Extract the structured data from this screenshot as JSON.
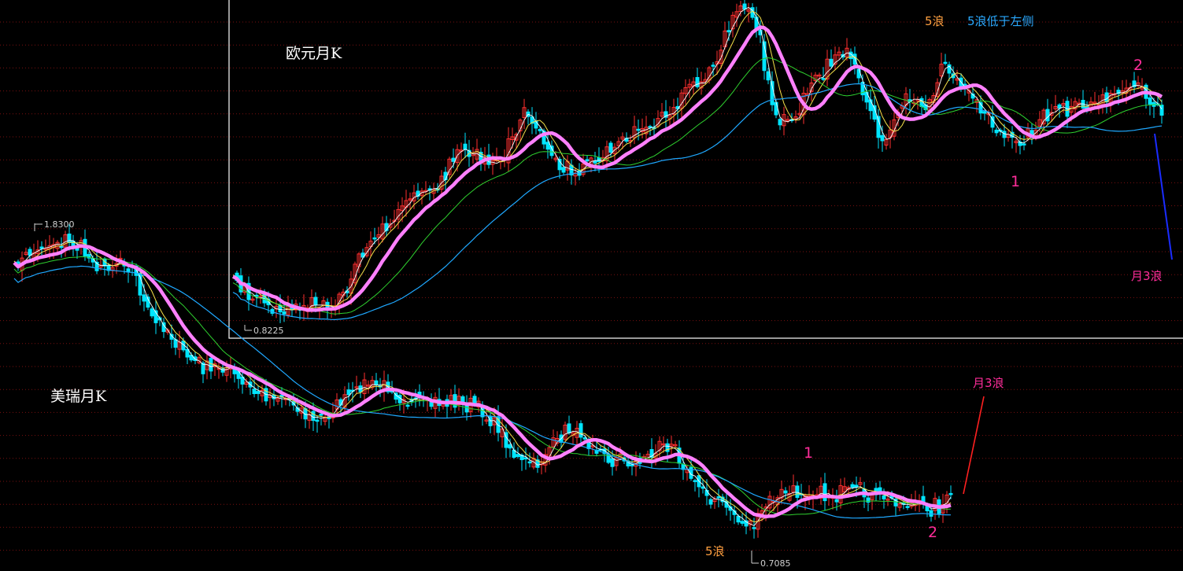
{
  "colors": {
    "background": "#000000",
    "up_candle": "#ff3030",
    "down_candle": "#00e5ff",
    "grid": "#7a1010",
    "ma_short": "#ffffff",
    "ma_mid": "#f5e14a",
    "ma_long": "#2fd12f",
    "ma_longer": "#1fa8ff",
    "ma_main": "#ff80ff",
    "label_pink": "#ff2d9a",
    "label_orange": "#ffa040",
    "label_blue": "#2aa9ff",
    "arrow_blue": "#1a2cff",
    "arrow_red": "#ff2020"
  },
  "annotations": {
    "eur_title": "欧元月K",
    "chf_title": "美瑞月K",
    "eur_wave1": "1",
    "eur_wave2": "2",
    "eur_wave3": "月3浪",
    "eur_wave5": "5浪",
    "eur_wave5_note": "5浪低于左侧",
    "chf_wave1": "1",
    "chf_wave2": "2",
    "chf_wave3": "月3浪",
    "chf_wave5": "5浪",
    "eur_low": "0.8225",
    "chf_high": "1.8300",
    "chf_low": "0.7085"
  },
  "chart_data": [
    {
      "type": "candlestick",
      "title": "欧元月K",
      "note": "monthly candlesticks with moving averages (values estimated, chart has no value axis)",
      "price_labels": [
        "0.8225"
      ],
      "series_shape": [
        1.0,
        0.92,
        0.86,
        0.84,
        0.88,
        1.0,
        1.1,
        1.18,
        1.24,
        1.28,
        1.3,
        1.34,
        1.22,
        1.18,
        1.2,
        1.22,
        1.24,
        1.3,
        1.38,
        1.46,
        1.54,
        1.58,
        1.5,
        1.42,
        1.4,
        1.38,
        1.41,
        1.39,
        1.36,
        1.33,
        1.3,
        1.24,
        1.2,
        1.22,
        1.25,
        1.26,
        1.24,
        1.18,
        1.1
      ]
    },
    {
      "type": "candlestick",
      "title": "美瑞月K",
      "note": "monthly candlesticks with moving averages (values estimated, chart has no value axis)",
      "price_labels": [
        "1.8300",
        "0.7085"
      ],
      "series_shape": [
        1.7,
        1.76,
        1.8,
        1.74,
        1.72,
        1.66,
        1.56,
        1.48,
        1.42,
        1.38,
        1.32,
        1.26,
        1.24,
        1.26,
        1.28,
        1.25,
        1.22,
        1.2,
        1.16,
        1.12,
        1.06,
        1.02,
        1.04,
        1.01,
        0.98,
        0.94,
        0.88,
        0.8,
        0.74,
        0.78,
        0.82,
        0.8,
        0.79,
        0.8,
        0.78,
        0.77,
        0.76,
        0.8
      ]
    }
  ]
}
